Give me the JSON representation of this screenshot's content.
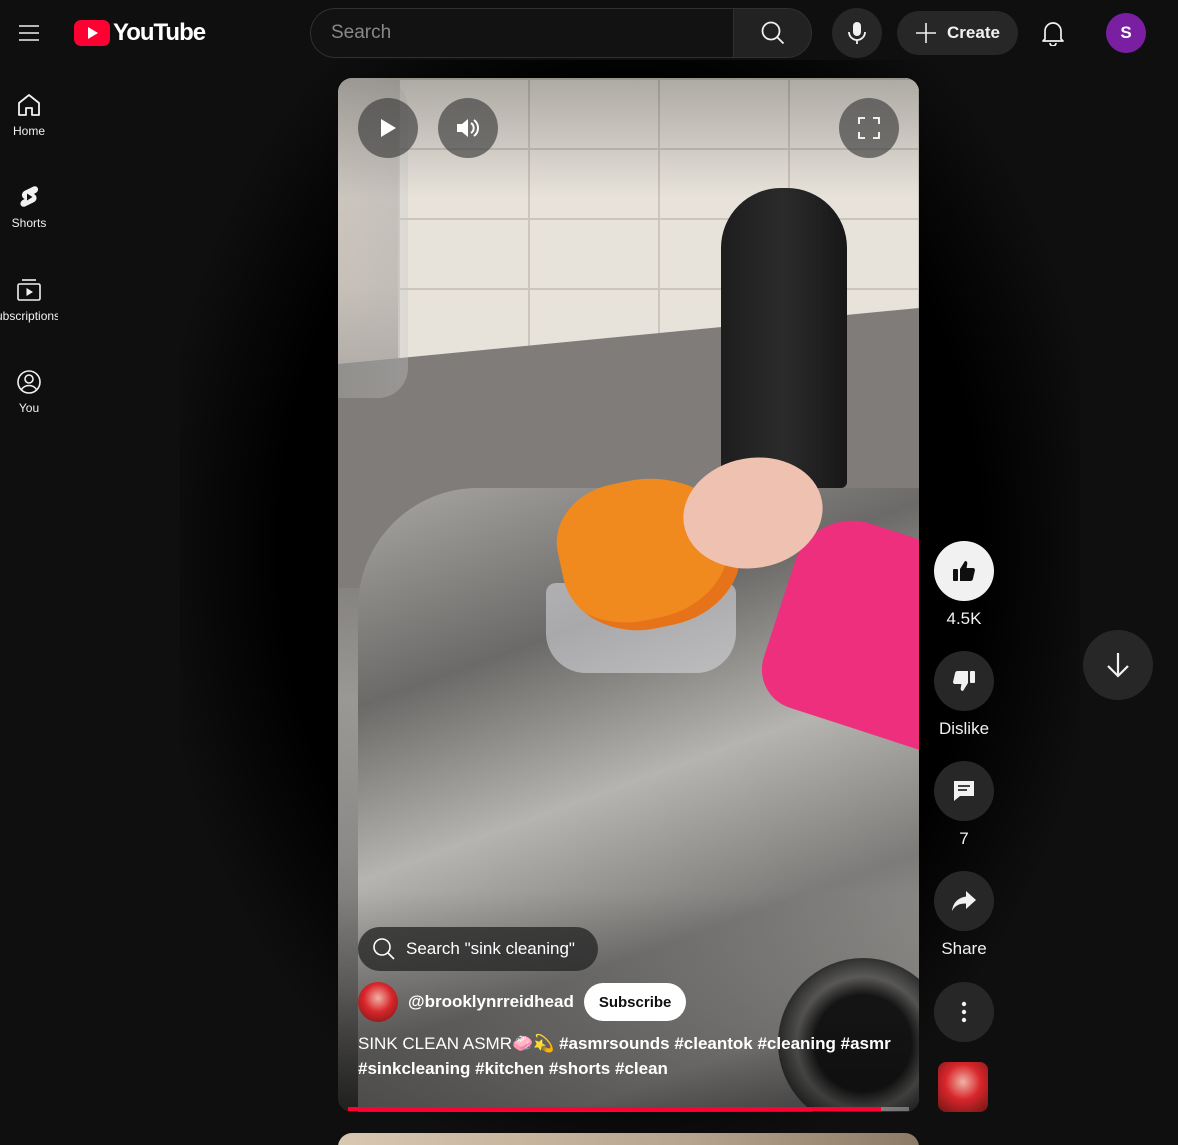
{
  "header": {
    "logo_text": "YouTube",
    "search_placeholder": "Search",
    "create_label": "Create",
    "avatar_letter": "S"
  },
  "sidebar": {
    "items": [
      {
        "label": "Home",
        "icon": "home-icon"
      },
      {
        "label": "Shorts",
        "icon": "shorts-icon"
      },
      {
        "label": "Subscriptions",
        "icon": "subscriptions-icon"
      },
      {
        "label": "You",
        "icon": "you-icon"
      }
    ]
  },
  "short": {
    "search_chip": "Search \"sink cleaning\"",
    "channel": "@brooklynrreidhead",
    "subscribe_label": "Subscribe",
    "title": "SINK CLEAN ASMR🧼💫",
    "hashtags_line1": "#asmrsounds #cleantok #cleaning #asmr",
    "hashtags_line2": "#sinkcleaning #kitchen #shorts #clean",
    "progress_percent": 95
  },
  "actions": {
    "like_count": "4.5K",
    "dislike_label": "Dislike",
    "comment_count": "7",
    "share_label": "Share"
  },
  "colors": {
    "accent": "#ff0033",
    "background": "#0f0f0f",
    "avatar": "#7b1fa2"
  }
}
